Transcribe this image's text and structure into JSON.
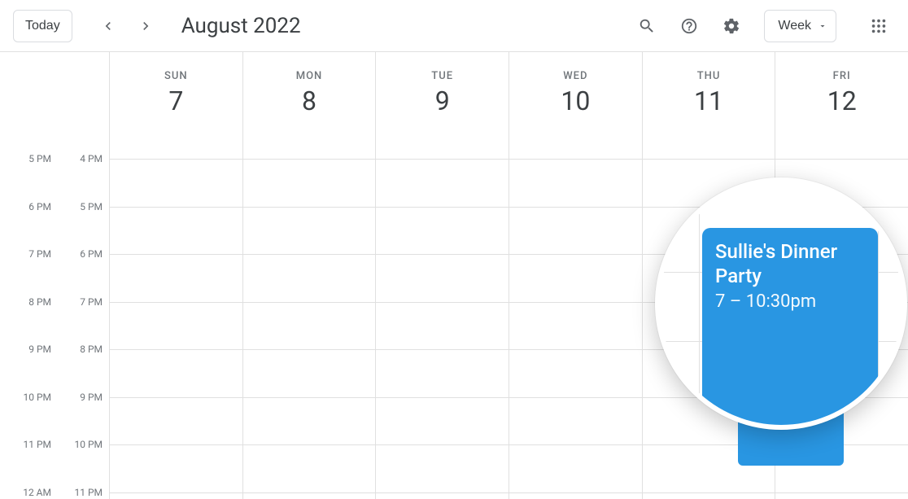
{
  "header": {
    "today_label": "Today",
    "title": "August 2022",
    "view_label": "Week"
  },
  "days": [
    {
      "name": "SUN",
      "num": "7"
    },
    {
      "name": "MON",
      "num": "8"
    },
    {
      "name": "TUE",
      "num": "9"
    },
    {
      "name": "WED",
      "num": "10"
    },
    {
      "name": "THU",
      "num": "11"
    },
    {
      "name": "FRI",
      "num": "12"
    }
  ],
  "time_labels_left": [
    "5 PM",
    "6 PM",
    "7 PM",
    "8 PM",
    "9 PM",
    "10 PM",
    "11 PM",
    "12 AM"
  ],
  "time_labels_right": [
    "4 PM",
    "5 PM",
    "6 PM",
    "7 PM",
    "8 PM",
    "9 PM",
    "10 PM",
    "11 PM"
  ],
  "event": {
    "title": "Sullie's Dinner Party",
    "time": "7 – 10:30pm"
  }
}
